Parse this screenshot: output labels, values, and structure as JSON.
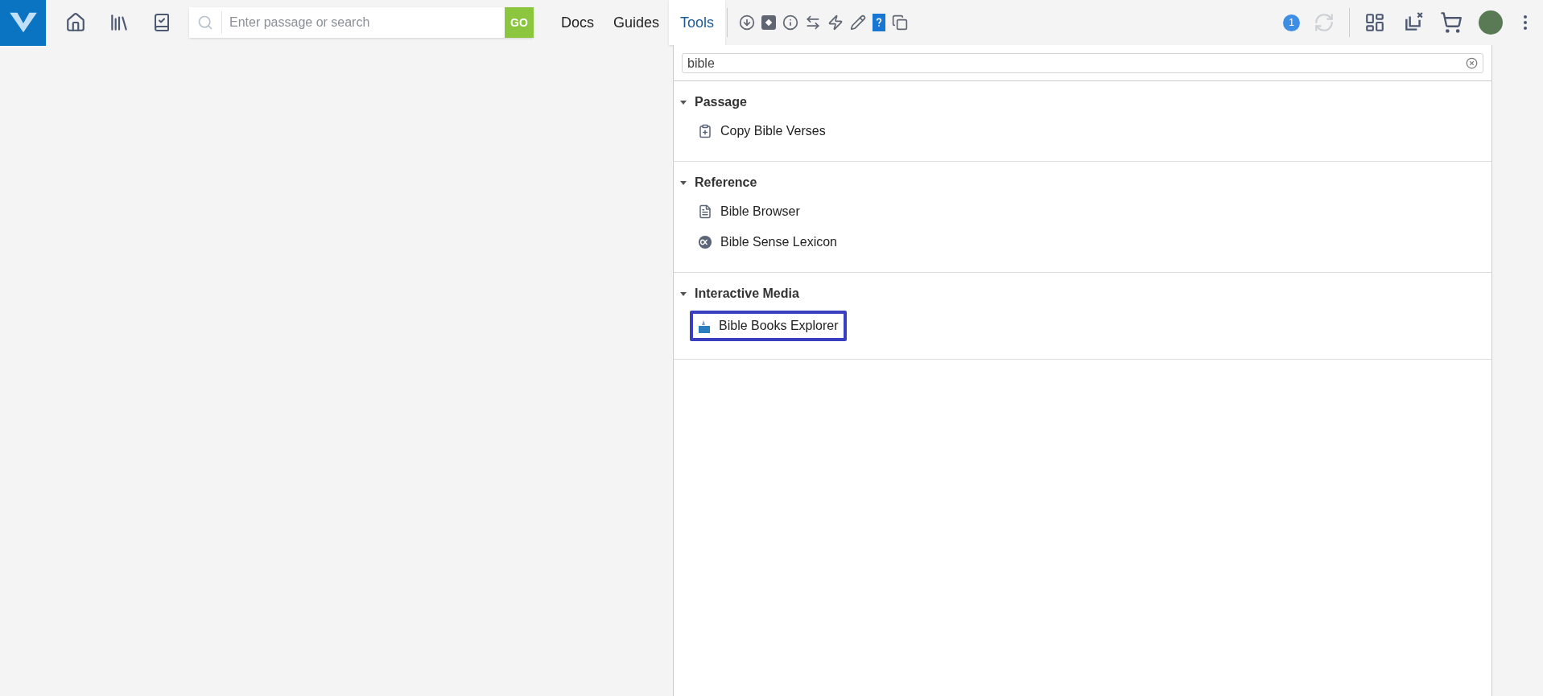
{
  "search": {
    "placeholder": "Enter passage or search",
    "go_label": "GO"
  },
  "nav_tabs": [
    {
      "label": "Docs",
      "selected": false
    },
    {
      "label": "Guides",
      "selected": false
    },
    {
      "label": "Tools",
      "selected": true
    }
  ],
  "notifications": {
    "count": "1"
  },
  "tools_panel": {
    "filter": {
      "value": "bible"
    },
    "sections": [
      {
        "title": "Passage",
        "expanded": true,
        "items": [
          {
            "label": "Copy Bible Verses",
            "kind": "clipboard",
            "selected": false
          }
        ]
      },
      {
        "title": "Reference",
        "expanded": true,
        "items": [
          {
            "label": "Bible Browser",
            "kind": "list",
            "selected": false
          },
          {
            "label": "Bible Sense Lexicon",
            "kind": "lexicon",
            "selected": false
          }
        ]
      },
      {
        "title": "Interactive Media",
        "expanded": true,
        "items": [
          {
            "label": "Bible Books Explorer",
            "kind": "media",
            "selected": true
          }
        ]
      }
    ]
  }
}
